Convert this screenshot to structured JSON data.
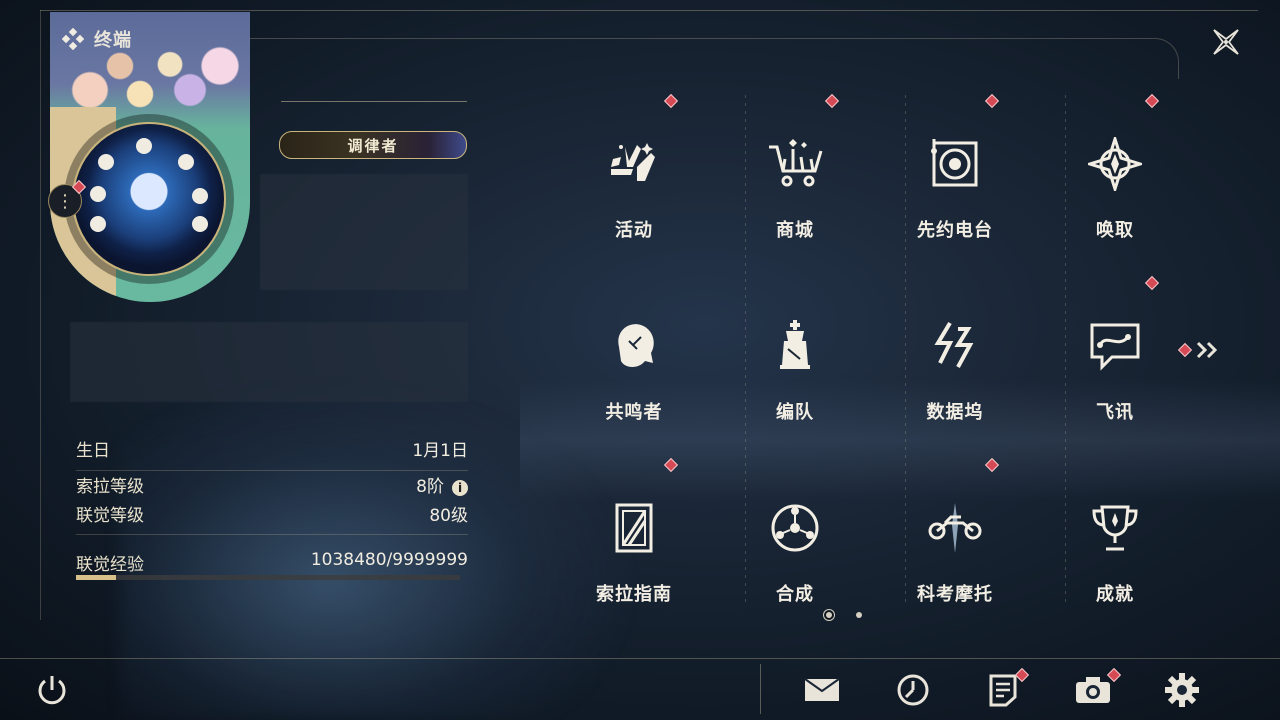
{
  "header": {
    "title": "终端",
    "close_icon": "close-icon"
  },
  "profile": {
    "rank_title": "调律者",
    "stats": [
      {
        "label": "生日",
        "value": "1月1日"
      },
      {
        "label": "索拉等级",
        "value": "8阶"
      },
      {
        "label": "联觉等级",
        "value": "80级"
      },
      {
        "label": "联觉经验",
        "value": "1038480/9999999"
      }
    ],
    "exp_progress": 0.104,
    "info_icon": "i"
  },
  "menu": {
    "items": [
      {
        "label": "活动",
        "icon": "activity-icon",
        "badge": true
      },
      {
        "label": "商城",
        "icon": "shop-cart-icon",
        "badge": true
      },
      {
        "label": "先约电台",
        "icon": "radio-icon",
        "badge": true
      },
      {
        "label": "唤取",
        "icon": "gacha-compass-icon",
        "badge": true
      },
      {
        "label": "共鸣者",
        "icon": "resonator-icon",
        "badge": false
      },
      {
        "label": "编队",
        "icon": "chess-team-icon",
        "badge": false
      },
      {
        "label": "数据坞",
        "icon": "databank-icon",
        "badge": false
      },
      {
        "label": "飞讯",
        "icon": "chat-icon",
        "badge": true
      },
      {
        "label": "索拉指南",
        "icon": "guide-book-icon",
        "badge": true
      },
      {
        "label": "合成",
        "icon": "synthesis-icon",
        "badge": false
      },
      {
        "label": "科考摩托",
        "icon": "motorbike-icon",
        "badge": true
      },
      {
        "label": "成就",
        "icon": "trophy-icon",
        "badge": false
      }
    ],
    "page_count": 2,
    "current_page": 1
  },
  "bottom_bar": {
    "icons": [
      "power-icon",
      "mail-icon",
      "clock-icon",
      "notes-icon",
      "camera-icon",
      "settings-gear-icon"
    ]
  },
  "colors": {
    "accent_gold": "#c9b57d",
    "badge_red": "#d64a55",
    "teal": "#69b9a0"
  }
}
